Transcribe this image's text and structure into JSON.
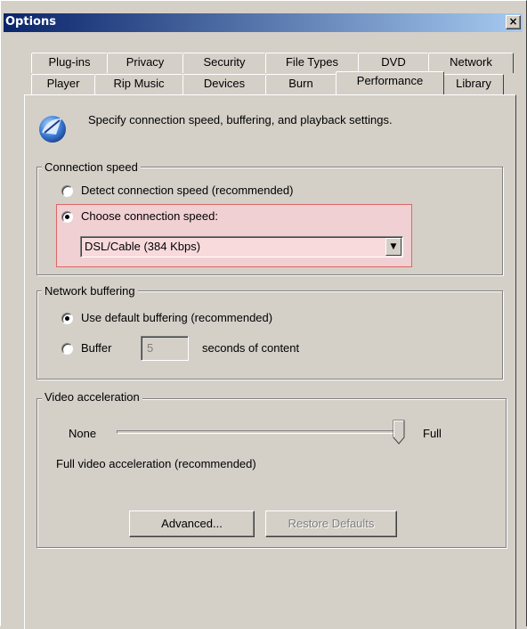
{
  "window": {
    "title": "Options",
    "close_glyph": "×"
  },
  "tabs_row1": [
    "Plug-ins",
    "Privacy",
    "Security",
    "File Types",
    "DVD",
    "Network"
  ],
  "tabs_row2": [
    "Player",
    "Rip Music",
    "Devices",
    "Burn",
    "Performance",
    "Library"
  ],
  "active_tab": "Performance",
  "header": {
    "icon": "performance-gauge-icon",
    "text": "Specify connection speed, buffering, and playback settings."
  },
  "connection": {
    "group_label": "Connection speed",
    "detect_label": "Detect connection speed (recommended)",
    "choose_label": "Choose connection speed:",
    "selected": "choose",
    "speed_value": "DSL/Cable (384 Kbps)"
  },
  "buffering": {
    "group_label": "Network buffering",
    "default_label": "Use default buffering (recommended)",
    "buffer_label": "Buffer",
    "buffer_value": "5",
    "seconds_label": "seconds of content",
    "selected": "default"
  },
  "video": {
    "group_label": "Video acceleration",
    "min_label": "None",
    "max_label": "Full",
    "level": 1.0,
    "status_text": "Full video acceleration (recommended)",
    "advanced_label": "Advanced...",
    "restore_label": "Restore Defaults"
  },
  "colors": {
    "title_start": "#0a246a",
    "title_end": "#a6caf0",
    "highlight": "#f1d0d3",
    "highlight_border": "#dd6666"
  }
}
